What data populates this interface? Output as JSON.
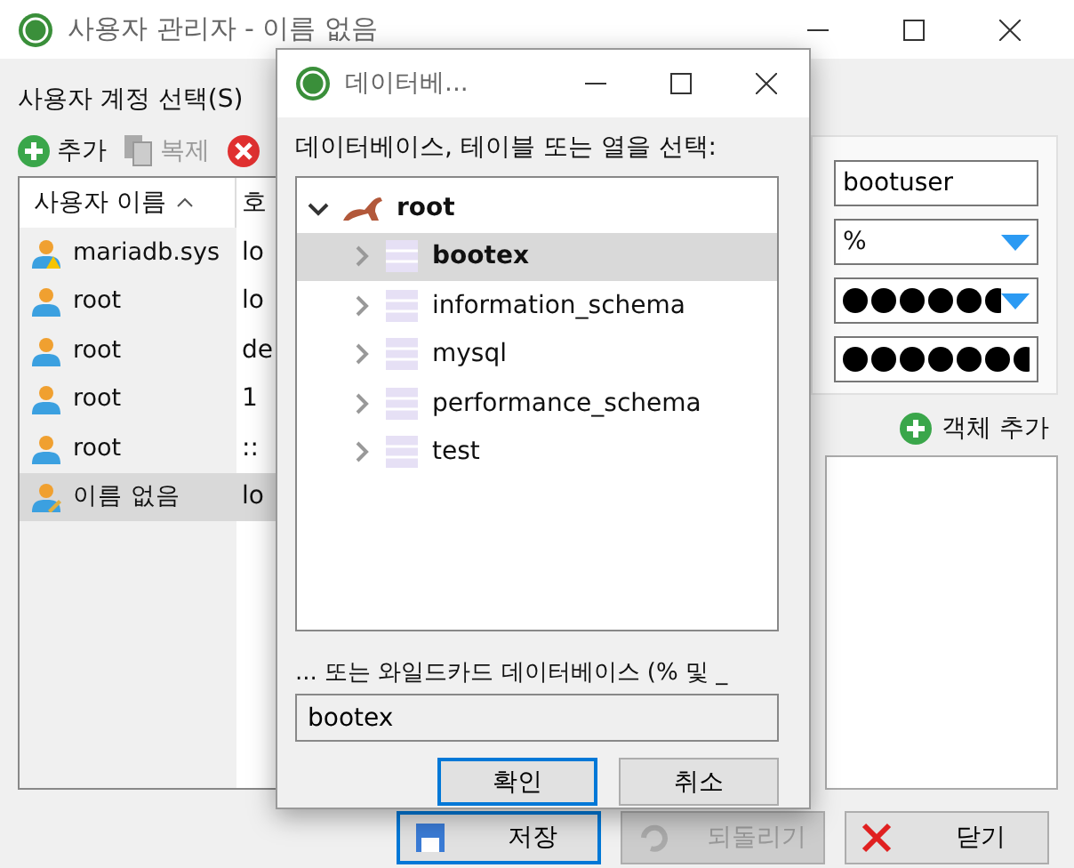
{
  "window": {
    "title": "사용자 관리자 - 이름 없음"
  },
  "account_heading": "사용자 계정 선택(S)",
  "toolbar": [
    {
      "kind": "add",
      "label": "추가",
      "disabled": false
    },
    {
      "kind": "copy",
      "label": "복제",
      "disabled": true
    },
    {
      "kind": "delete"
    }
  ],
  "user_table": {
    "columns": [
      "사용자 이름",
      "호"
    ],
    "rows": [
      {
        "name": "mariadb.sys",
        "host": "lo",
        "kind": "warning",
        "selected": false
      },
      {
        "name": "root",
        "host": "lo",
        "kind": "normal",
        "selected": false
      },
      {
        "name": "root",
        "host": "de",
        "kind": "normal",
        "selected": false
      },
      {
        "name": "root",
        "host": "1",
        "kind": "normal",
        "selected": false
      },
      {
        "name": "root",
        "host": "::",
        "kind": "normal",
        "selected": false
      },
      {
        "name": "이름 없음",
        "host": "lo",
        "kind": "edit",
        "selected": true
      }
    ]
  },
  "credentials": {
    "username": "bootuser",
    "host": "%"
  },
  "add_object": "객체 추가",
  "buttons": [
    {
      "kind": "save",
      "label": "저장",
      "default": true,
      "disabled": false
    },
    {
      "kind": "revert",
      "label": "되돌리기",
      "default": false,
      "disabled": true
    },
    {
      "kind": "close",
      "label": "닫기",
      "default": false,
      "disabled": false
    }
  ],
  "dialog": {
    "title": "데이터베...",
    "prompt": "데이터베이스, 테이블 또는 열을 선택:",
    "tree": {
      "label": "root",
      "expanded": true,
      "children": [
        {
          "label": "bootex",
          "selected": true,
          "expanded": false
        },
        {
          "label": "information_schema",
          "selected": false,
          "expanded": false
        },
        {
          "label": "mysql",
          "selected": false,
          "expanded": false
        },
        {
          "label": "performance_schema",
          "selected": false,
          "expanded": false
        },
        {
          "label": "test",
          "selected": false,
          "expanded": false
        }
      ]
    },
    "wildcard_label": "... 또는 와일드카드 데이터베이스 (% 및 _",
    "wildcard_value": "bootex",
    "buttons": [
      {
        "label": "확인",
        "default": true
      },
      {
        "label": "취소",
        "default": false
      }
    ]
  }
}
